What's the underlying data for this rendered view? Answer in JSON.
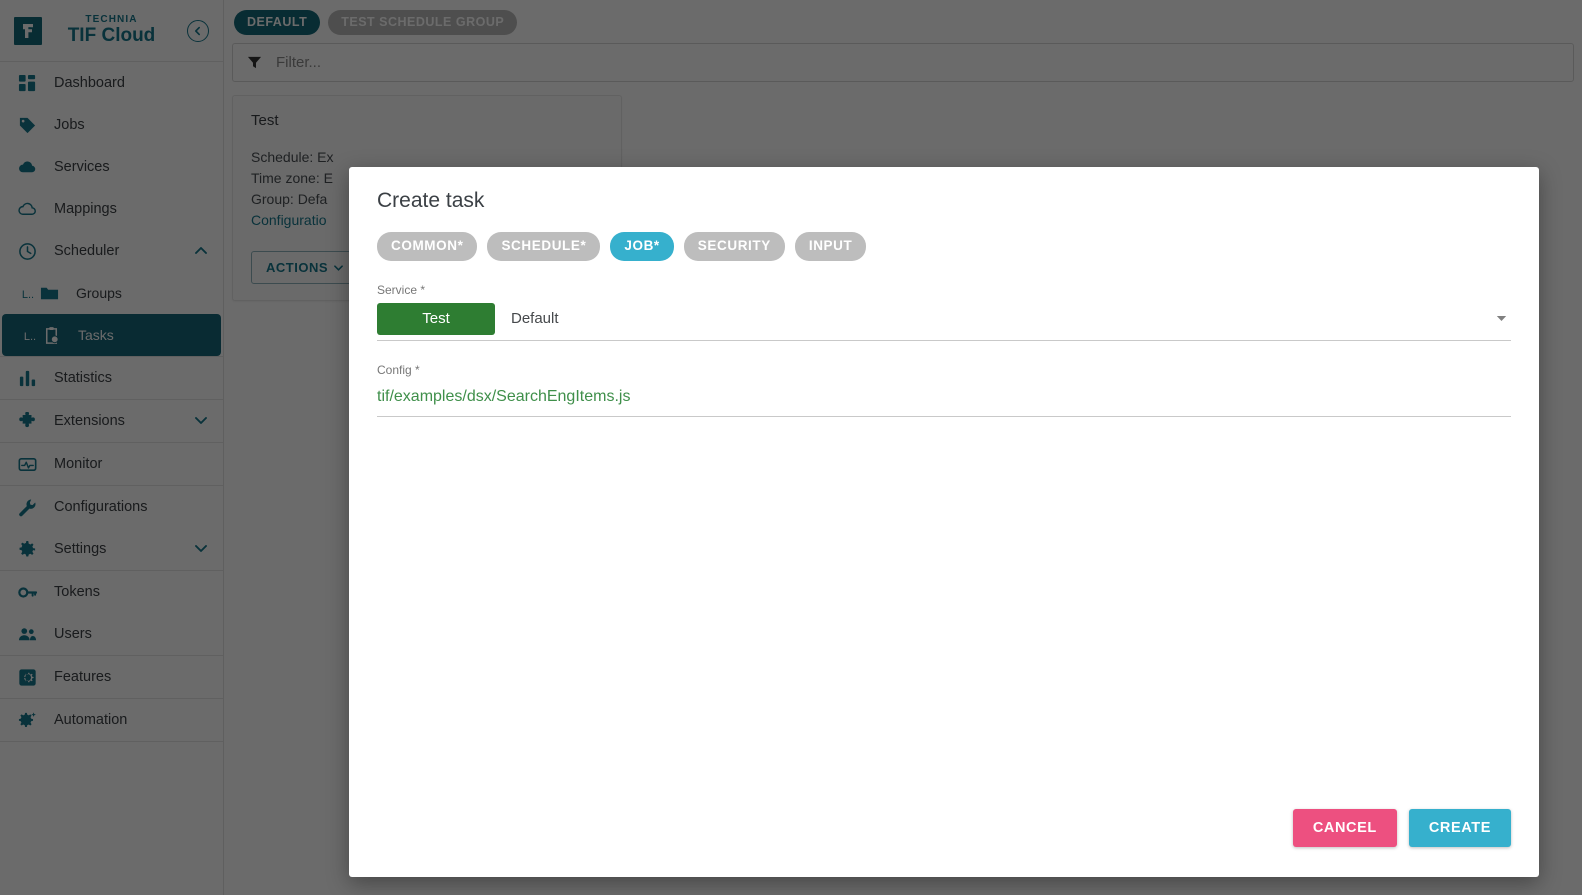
{
  "sidebar": {
    "brand": {
      "sub": "TECHNIA",
      "title": "TIF Cloud",
      "collapse_icon": "arrow-left-circle-icon",
      "logo_icon": "technia-logo-icon"
    },
    "groups": [
      {
        "items": [
          {
            "label": "Dashboard",
            "icon": "dashboard-icon",
            "active": false
          },
          {
            "label": "Jobs",
            "icon": "tag-icon",
            "active": false
          },
          {
            "label": "Services",
            "icon": "cloud-filled-icon",
            "active": false
          },
          {
            "label": "Mappings",
            "icon": "cloud-outline-icon",
            "active": false
          },
          {
            "label": "Scheduler",
            "icon": "clock-icon",
            "active": false,
            "chevron": "chevron-up-icon"
          },
          {
            "label": "Groups",
            "icon": "folder-icon",
            "sub": true,
            "active": false
          },
          {
            "label": "Tasks",
            "icon": "clipboard-clock-icon",
            "sub": true,
            "active": true
          }
        ]
      },
      {
        "items": [
          {
            "label": "Statistics",
            "icon": "bar-chart-icon",
            "active": false
          }
        ]
      },
      {
        "items": [
          {
            "label": "Extensions",
            "icon": "puzzle-icon",
            "active": false,
            "chevron": "chevron-down-icon"
          }
        ]
      },
      {
        "items": [
          {
            "label": "Monitor",
            "icon": "monitor-pulse-icon",
            "active": false
          }
        ]
      },
      {
        "items": [
          {
            "label": "Configurations",
            "icon": "wrench-icon",
            "active": false
          },
          {
            "label": "Settings",
            "icon": "gear-icon",
            "active": false,
            "chevron": "chevron-down-icon"
          }
        ]
      },
      {
        "items": [
          {
            "label": "Tokens",
            "icon": "key-icon",
            "active": false
          },
          {
            "label": "Users",
            "icon": "users-icon",
            "active": false
          }
        ]
      },
      {
        "items": [
          {
            "label": "Features",
            "icon": "feature-square-icon",
            "active": false
          }
        ]
      },
      {
        "items": [
          {
            "label": "Automation",
            "icon": "gear-sparkle-icon",
            "active": false
          }
        ]
      }
    ]
  },
  "main": {
    "chips": [
      {
        "label": "DEFAULT",
        "selected": true
      },
      {
        "label": "TEST SCHEDULE GROUP",
        "selected": false
      }
    ],
    "filter": {
      "placeholder": "Filter...",
      "value": "",
      "icon": "filter-icon"
    },
    "card": {
      "title": "Test",
      "line1": "Schedule: Ex",
      "line2": "Time zone: E",
      "line3": "Group: Defa",
      "link": "Configuratio",
      "actions_label": "ACTIONS",
      "actions_caret": "chevron-down-icon"
    }
  },
  "modal": {
    "title": "Create task",
    "tabs": [
      {
        "label": "COMMON*",
        "active": false
      },
      {
        "label": "SCHEDULE*",
        "active": false
      },
      {
        "label": "JOB*",
        "active": true
      },
      {
        "label": "SECURITY",
        "active": false
      },
      {
        "label": "INPUT",
        "active": false
      }
    ],
    "service": {
      "label": "Service *",
      "badge": "Test",
      "value": "Default",
      "caret": "chevron-down-icon"
    },
    "config": {
      "label": "Config *",
      "value": "tif/examples/dsx/SearchEngItems.js"
    },
    "footer": {
      "cancel": "CANCEL",
      "create": "CREATE"
    }
  },
  "colors": {
    "brand_teal": "#17788c",
    "active_nav": "#17687a",
    "tab_active": "#36b0cd",
    "tab_inactive": "#bdbdbd",
    "service_green": "#2e7d32",
    "config_green": "#3f8f4a",
    "cancel_pink": "#ed5080",
    "create_blue": "#36b0cd",
    "chip_selected": "#14697a",
    "chip_unselected": "#b9b9b9"
  }
}
